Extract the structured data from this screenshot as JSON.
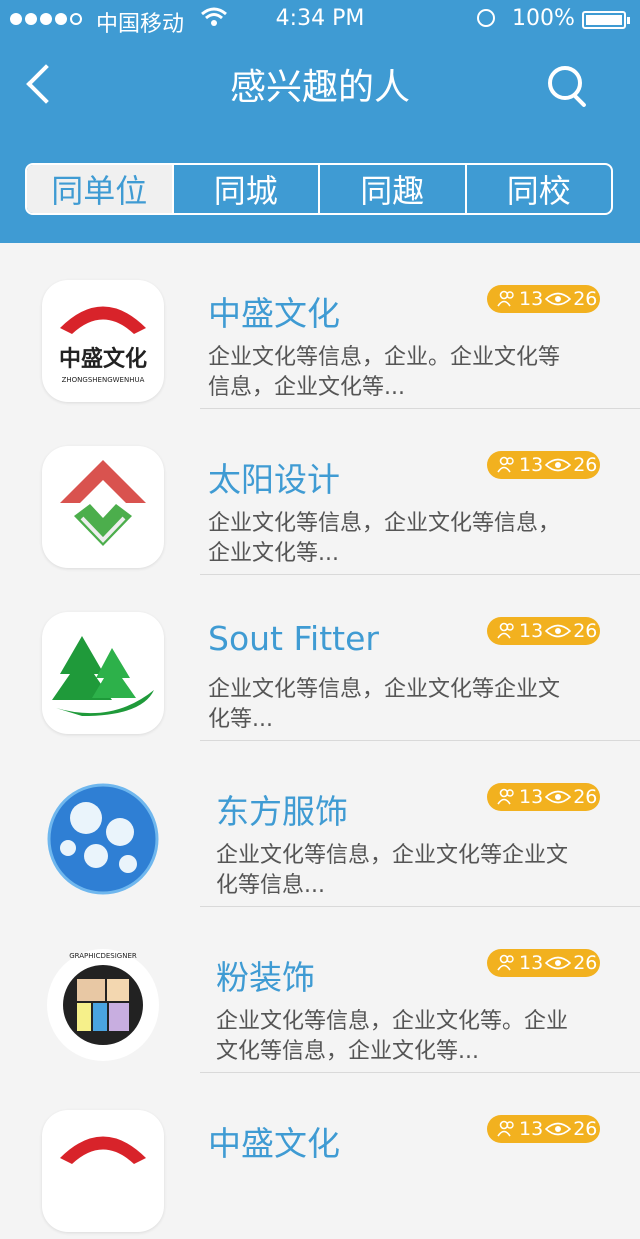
{
  "status_bar": {
    "carrier": "中国移动",
    "time": "4:34 PM",
    "battery": "100%"
  },
  "nav": {
    "title": "感兴趣的人"
  },
  "tabs": [
    {
      "label": "同单位",
      "active": true
    },
    {
      "label": "同城",
      "active": false
    },
    {
      "label": "同趣",
      "active": false
    },
    {
      "label": "同校",
      "active": false
    }
  ],
  "items": [
    {
      "title": "中盛文化",
      "desc": "企业文化等信息，企业。企业文化等信息，企业文化等...",
      "members": "13",
      "views": "26",
      "logo": "zhongsheng-logo"
    },
    {
      "title": "太阳设计",
      "desc": "企业文化等信息，企业文化等信息，企业文化等...",
      "members": "13",
      "views": "26",
      "logo": "taiyang-logo"
    },
    {
      "title": "Sout Fitter",
      "desc": "企业文化等信息，企业文化等企业文化等...",
      "members": "13",
      "views": "26",
      "logo": "tree-logo"
    },
    {
      "title": "东方服饰",
      "desc": "企业文化等信息，企业文化等企业文化等信息...",
      "members": "13",
      "views": "26",
      "logo": "sphere-logo"
    },
    {
      "title": "粉装饰",
      "desc": "企业文化等信息，企业文化等。企业文化等信息，企业文化等...",
      "members": "13",
      "views": "26",
      "logo": "graphic-designer-logo"
    },
    {
      "title": "中盛文化",
      "desc": "",
      "members": "13",
      "views": "26",
      "logo": "zhongsheng-logo"
    }
  ],
  "logo_text": {
    "zhongsheng_main": "中盛文化",
    "zhongsheng_sub": "ZHONGSHENGWENHUA",
    "graphic": "GRAPHICDESIGNER"
  },
  "colors": {
    "header": "#3f9bd3",
    "badge": "#f2b11f",
    "title": "#3f9bd3"
  }
}
